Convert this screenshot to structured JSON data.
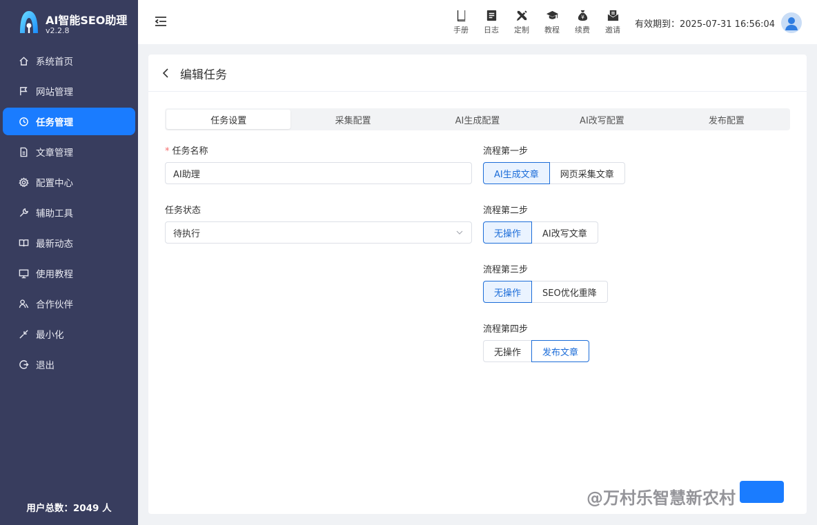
{
  "brand": {
    "title": "AI智能SEO助理",
    "version": "v2.2.8"
  },
  "sidebar": {
    "items": [
      {
        "label": "系统首页",
        "icon": "home-icon"
      },
      {
        "label": "网站管理",
        "icon": "flag-icon"
      },
      {
        "label": "任务管理",
        "icon": "clock-icon",
        "active": true
      },
      {
        "label": "文章管理",
        "icon": "document-icon"
      },
      {
        "label": "配置中心",
        "icon": "gear-icon"
      },
      {
        "label": "辅助工具",
        "icon": "wrench-icon"
      },
      {
        "label": "最新动态",
        "icon": "book-icon"
      },
      {
        "label": "使用教程",
        "icon": "monitor-icon"
      },
      {
        "label": "合作伙伴",
        "icon": "partner-icon"
      },
      {
        "label": "最小化",
        "icon": "minimize-icon"
      },
      {
        "label": "退出",
        "icon": "logout-icon"
      }
    ],
    "user_total": "用户总数：2049 人"
  },
  "header": {
    "tools": [
      {
        "label": "手册",
        "icon": "manual-icon"
      },
      {
        "label": "日志",
        "icon": "log-icon"
      },
      {
        "label": "定制",
        "icon": "customize-icon"
      },
      {
        "label": "教程",
        "icon": "graduation-cap-icon"
      },
      {
        "label": "续费",
        "icon": "money-bag-icon"
      },
      {
        "label": "邀请",
        "icon": "invite-icon"
      }
    ],
    "expiry": "有效期到：2025-07-31 16:56:04"
  },
  "page": {
    "title": "编辑任务",
    "tabs": [
      "任务设置",
      "采集配置",
      "AI生成配置",
      "AI改写配置",
      "发布配置"
    ],
    "active_tab": "任务设置",
    "form": {
      "task_name_label": "任务名称",
      "task_name_value": "AI助理",
      "task_status_label": "任务状态",
      "task_status_value": "待执行",
      "step1": {
        "label": "流程第一步",
        "options": [
          "AI生成文章",
          "网页采集文章"
        ],
        "selected": "AI生成文章"
      },
      "step2": {
        "label": "流程第二步",
        "options": [
          "无操作",
          "AI改写文章"
        ],
        "selected": "无操作"
      },
      "step3": {
        "label": "流程第三步",
        "options": [
          "无操作",
          "SEO优化重降"
        ],
        "selected": "无操作"
      },
      "step4": {
        "label": "流程第四步",
        "options": [
          "无操作",
          "发布文章"
        ],
        "selected": "发布文章"
      }
    }
  },
  "watermark": "@万村乐智慧新农村",
  "colors": {
    "sidebar_bg": "#383d5e",
    "accent": "#1a7cff",
    "selected_border": "#1b6cd8",
    "required": "#f56c6c"
  }
}
